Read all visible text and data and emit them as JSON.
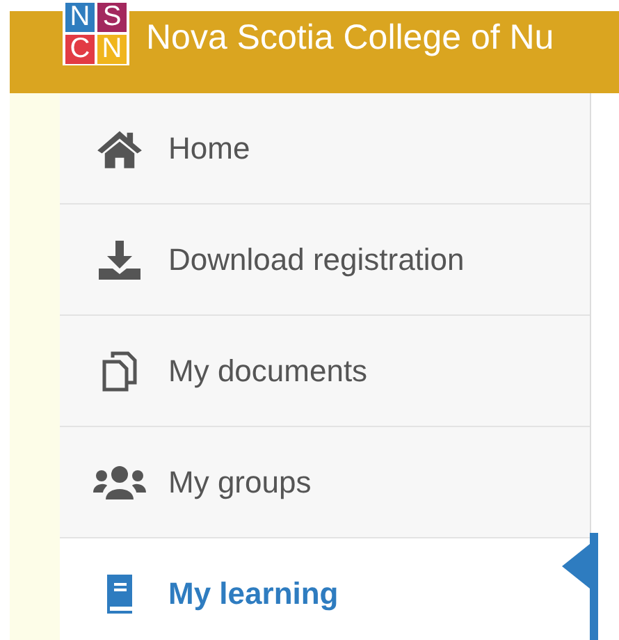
{
  "header": {
    "logo": {
      "letters": [
        {
          "text": "N",
          "color": "#2f7dbf"
        },
        {
          "text": "S",
          "color": "#a3285e"
        },
        {
          "text": "C",
          "color": "#e23b44"
        },
        {
          "text": "N",
          "color": "#f0b51c"
        }
      ]
    },
    "title": "Nova Scotia College of Nu"
  },
  "menu": [
    {
      "label": "Home",
      "selected": false
    },
    {
      "label": "Download registration",
      "selected": false
    },
    {
      "label": "My documents",
      "selected": false
    },
    {
      "label": "My groups",
      "selected": false
    },
    {
      "label": "My learning",
      "selected": true
    }
  ]
}
